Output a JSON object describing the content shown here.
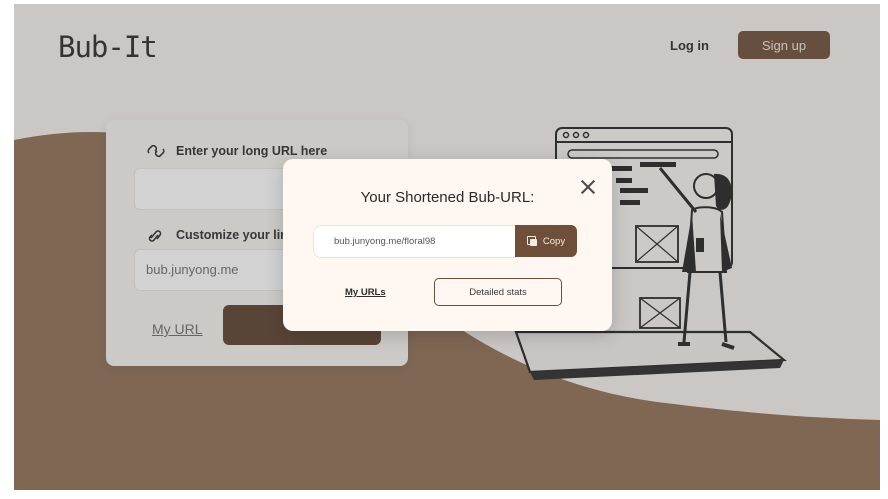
{
  "brand": {
    "logo": "Bub-It"
  },
  "nav": {
    "login": "Log in",
    "signup": "Sign up"
  },
  "form": {
    "long_url_label": "Enter your long URL here",
    "customize_label": "Customize your link",
    "prefix": "bub.junyong.me",
    "my_url_link": "My URL"
  },
  "modal": {
    "title": "Your Shortened Bub-URL:",
    "short_url": "bub.junyong.me/floral98",
    "copy_label": "Copy",
    "my_urls_link": "My URLs",
    "detailed_stats_button": "Detailed stats"
  },
  "colors": {
    "accent": "#6f4f3a",
    "wave": "#8f6f56",
    "background": "#f5f1ec"
  },
  "icons": {
    "long_url_icon": "chain-link-icon",
    "customize_icon": "link-icon",
    "close_icon": "close-icon",
    "copy_icon": "copy-icon"
  }
}
